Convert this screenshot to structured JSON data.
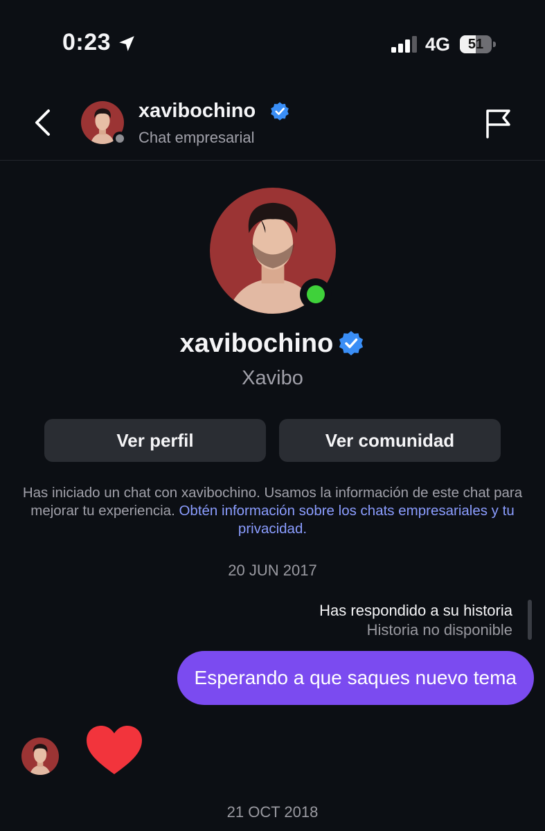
{
  "status_bar": {
    "time": "0:23",
    "network": "4G",
    "battery": "51",
    "battery_level": 0.51
  },
  "header": {
    "name": "xavibochino",
    "subtitle": "Chat empresarial",
    "icons": {
      "back": "chevron-left-icon",
      "flag": "flag-icon",
      "verified": "verified-badge-icon"
    }
  },
  "profile": {
    "username": "xavibochino",
    "display_name": "Xavibo",
    "online": true
  },
  "actions": {
    "view_profile": "Ver perfil",
    "view_community": "Ver comunidad"
  },
  "info": {
    "text": "Has iniciado un chat con xavibochino. Usamos la información de este chat para mejorar tu experiencia. ",
    "link": "Obtén información sobre los chats empresariales y tu privacidad."
  },
  "conversation": {
    "date1": "20 JUN 2017",
    "story_reply": {
      "title": "Has respondido a su historia",
      "subtitle": "Historia no disponible"
    },
    "sent_message": "Esperando a que saques nuevo tema",
    "reaction": "heart",
    "date2": "21 OCT 2018"
  },
  "colors": {
    "background": "#0c0f14",
    "bubble": "#7b4bf0",
    "link": "#8b9dff",
    "verified": "#3a8ef6",
    "online": "#3fd13a",
    "heart": "#f2343c"
  }
}
